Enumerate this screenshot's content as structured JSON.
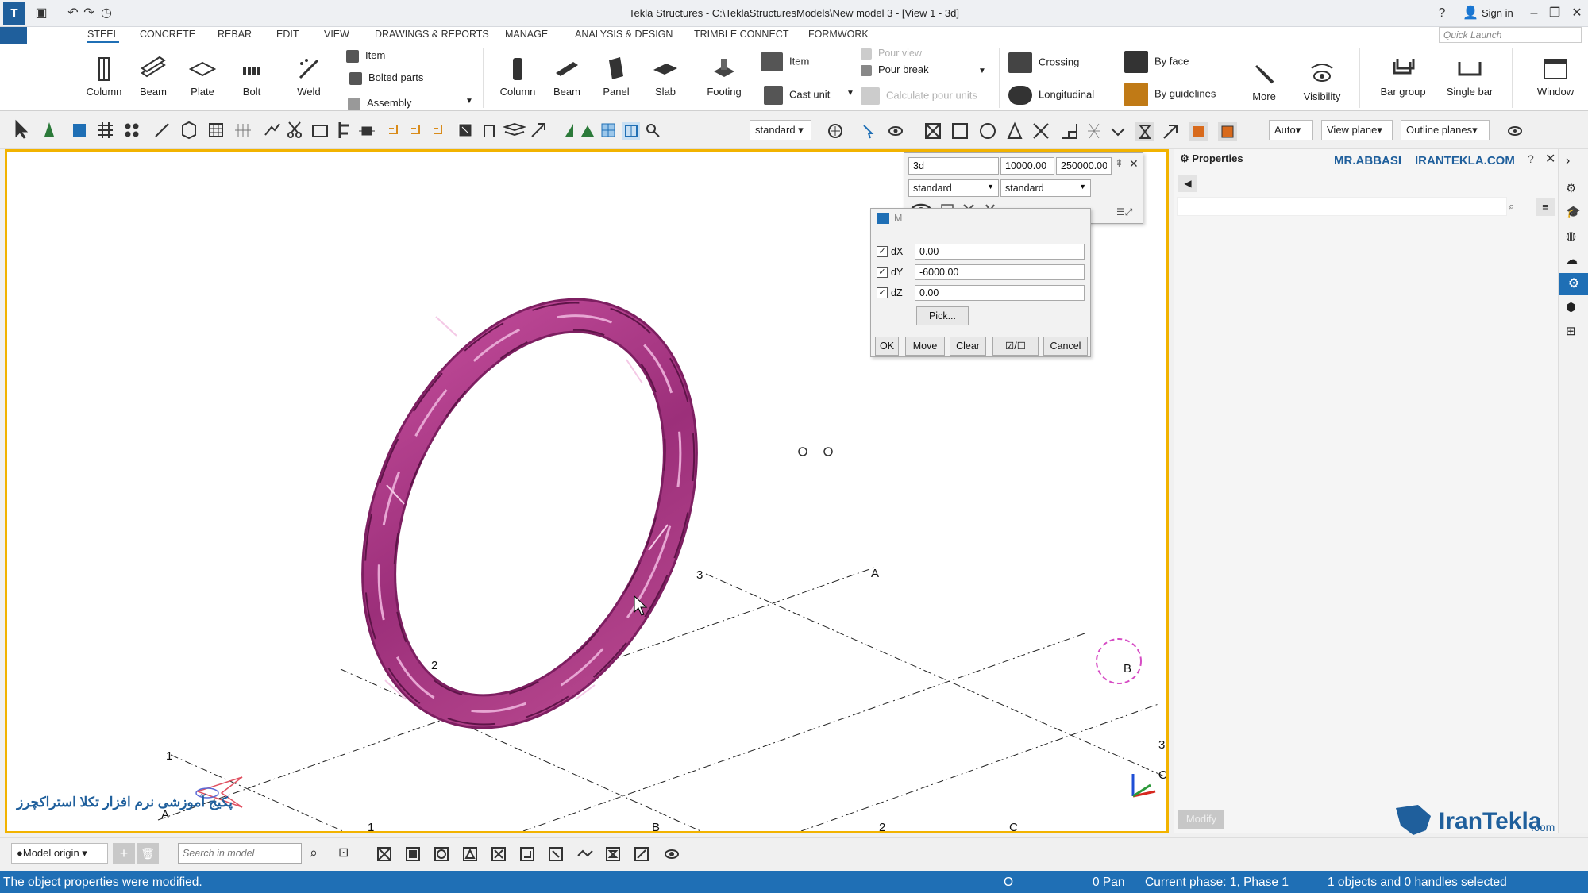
{
  "window": {
    "title": "Tekla Structures - C:\\TeklaStructuresModels\\New model 3 - [View 1 - 3d]",
    "sign_in": "Sign in",
    "quick_launch_placeholder": "Quick Launch"
  },
  "tabs": [
    "STEEL",
    "CONCRETE",
    "REBAR",
    "EDIT",
    "VIEW",
    "DRAWINGS & REPORTS",
    "MANAGE",
    "ANALYSIS & DESIGN",
    "TRIMBLE CONNECT",
    "FORMWORK"
  ],
  "ribbon": {
    "steel": {
      "column": "Column",
      "beam": "Beam",
      "plate": "Plate",
      "bolt": "Bolt",
      "weld": "Weld",
      "item": "Item",
      "bolted_parts": "Bolted parts",
      "assembly": "Assembly"
    },
    "concrete": {
      "column": "Column",
      "beam": "Beam",
      "panel": "Panel",
      "slab": "Slab",
      "footing": "Footing",
      "item": "Item",
      "cast_unit": "Cast unit",
      "pour_view": "Pour view",
      "pour_break": "Pour break",
      "calculate_pour_units": "Calculate pour units"
    },
    "rebar": {
      "crossing": "Crossing",
      "longitudinal": "Longitudinal",
      "by_face": "By face",
      "by_guidelines": "By guidelines",
      "more": "More",
      "visibility": "Visibility",
      "bar_group": "Bar group",
      "single_bar": "Single bar"
    },
    "window": "Window"
  },
  "toolbar": {
    "combo_standard": "standard",
    "combo_auto": "Auto",
    "combo_view_plane": "View plane",
    "combo_outline_planes": "Outline planes"
  },
  "view_props": {
    "name": "3d",
    "depth_up": "10000.00",
    "depth_down": "250000.00",
    "rep1": "standard",
    "rep2": "standard"
  },
  "move_dialog": {
    "title_stub": "M",
    "dx_label": "dX",
    "dx": "0.00",
    "dy_label": "dY",
    "dy": "-6000.00",
    "dz_label": "dZ",
    "dz": "0.00",
    "pick": "Pick...",
    "ok": "OK",
    "move": "Move",
    "clear": "Clear",
    "toggle": "/",
    "cancel": "Cancel"
  },
  "grid": {
    "labels": [
      "1",
      "2",
      "3",
      "A",
      "B",
      "C",
      "A",
      "B",
      "C",
      "1",
      "2",
      "3",
      "2"
    ]
  },
  "properties": {
    "title": "Properties",
    "brand_name": "MR.ABBASI",
    "brand_site": "IRANTEKLA.COM",
    "modify": "Modify"
  },
  "watermark": {
    "persian": "پکیج آموزشی نرم افزار تکلا استراکچرز",
    "logo_main": "IranTekla",
    "logo_suffix": ".com"
  },
  "bottom": {
    "model_origin": "Model origin",
    "search_placeholder": "Search in model"
  },
  "status": {
    "message": "The object properties were modified.",
    "o": "O",
    "pan": "0 Pan",
    "phase": "Current phase: 1, Phase 1",
    "selection": "1 objects and 0 handles selected"
  },
  "colors": {
    "accent": "#1f6fb5",
    "viewport_border": "#f2b300",
    "ring": "#b0448e"
  }
}
